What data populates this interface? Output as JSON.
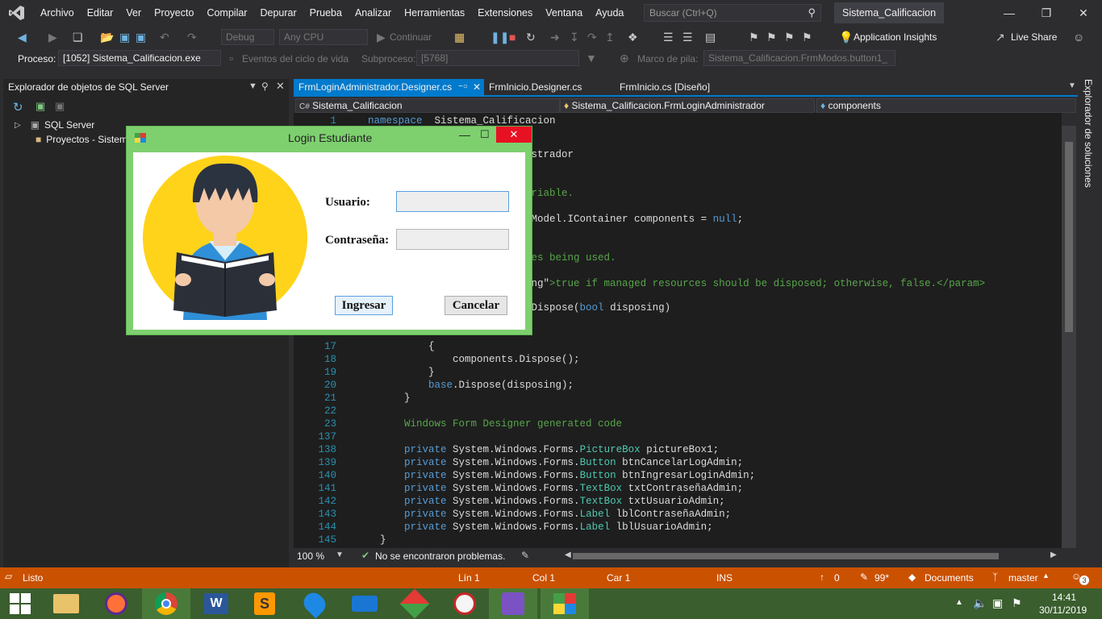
{
  "menu": [
    "Archivo",
    "Editar",
    "Ver",
    "Proyecto",
    "Compilar",
    "Depurar",
    "Prueba",
    "Analizar",
    "Herramientas",
    "Extensiones",
    "Ventana",
    "Ayuda"
  ],
  "search_placeholder": "Buscar (Ctrl+Q)",
  "solution_name": "Sistema_Calificacion",
  "toolbar": {
    "config": "Debug",
    "platform": "Any CPU",
    "continue_label": "Continuar",
    "app_insights": "Application Insights",
    "live_share": "Live Share"
  },
  "process_bar": {
    "proceso_label": "Proceso:",
    "proceso_value": "[1052] Sistema_Calificacion.exe",
    "eventos_label": "Eventos del ciclo de vida",
    "subproceso_label": "Subproceso:",
    "subproceso_value": "[5768]",
    "marco_label": "Marco de pila:",
    "marco_value": "Sistema_Calificacion.FrmModos.button1_"
  },
  "left_panel": {
    "title": "Explorador de objetos de SQL Server",
    "items": [
      "SQL Server",
      "Proyectos - Sistem"
    ]
  },
  "tabs": [
    "FrmLoginAdministrador.Designer.cs",
    "FrmInicio.Designer.cs",
    "FrmInicio.cs [Diseño]"
  ],
  "nav": {
    "project": "Sistema_Calificacion",
    "class": "Sistema_Calificacion.FrmLoginAdministrador",
    "member": "components"
  },
  "right_rail_label": "Explorador de soluciones",
  "code_lines": [
    {
      "n": "1",
      "segs": [
        [
          "kw",
          "namespace"
        ],
        [
          "",
          "  Sistema_Calificacion"
        ]
      ]
    },
    {
      "n": "",
      "segs": [
        [
          "",
          "                         nistrador"
        ]
      ]
    },
    {
      "n": "",
      "segs": [
        [
          "cm",
          "                         variable."
        ]
      ]
    },
    {
      "n": "",
      "segs": [
        [
          "",
          "                         ntModel.IContainer components = "
        ],
        [
          "kw",
          "null"
        ],
        [
          "",
          ";"
        ]
      ]
    },
    {
      "n": "",
      "segs": [
        [
          "cm",
          "                         rces being used."
        ]
      ]
    },
    {
      "n": "",
      "segs": [
        [
          "",
          "                         sing\""
        ],
        [
          "cm",
          ">true if managed resources should be disposed; otherwise, false.</param>"
        ]
      ]
    },
    {
      "n": "",
      "segs": [
        [
          "",
          "                         d Dispose("
        ],
        [
          "kw",
          "bool"
        ],
        [
          "",
          " disposing)"
        ]
      ]
    },
    {
      "n": "17",
      "segs": [
        [
          "",
          "          {"
        ]
      ]
    },
    {
      "n": "18",
      "segs": [
        [
          "",
          "              components.Dispose();"
        ]
      ]
    },
    {
      "n": "19",
      "segs": [
        [
          "",
          "          }"
        ]
      ]
    },
    {
      "n": "20",
      "segs": [
        [
          "",
          "          "
        ],
        [
          "kw",
          "base"
        ],
        [
          "",
          ".Dispose(disposing);"
        ]
      ]
    },
    {
      "n": "21",
      "segs": [
        [
          "",
          "      }"
        ]
      ]
    },
    {
      "n": "22",
      "segs": [
        [
          "",
          ""
        ]
      ]
    },
    {
      "n": "23",
      "segs": [
        [
          "",
          "      "
        ],
        [
          "cm",
          "Windows Form Designer generated code"
        ]
      ]
    },
    {
      "n": "137",
      "segs": [
        [
          "",
          ""
        ]
      ]
    },
    {
      "n": "138",
      "segs": [
        [
          "",
          "      "
        ],
        [
          "kw",
          "private"
        ],
        [
          "",
          " System.Windows.Forms."
        ],
        [
          "ty",
          "PictureBox"
        ],
        [
          "",
          " pictureBox1;"
        ]
      ]
    },
    {
      "n": "139",
      "segs": [
        [
          "",
          "      "
        ],
        [
          "kw",
          "private"
        ],
        [
          "",
          " System.Windows.Forms."
        ],
        [
          "ty",
          "Button"
        ],
        [
          "",
          " btnCancelarLogAdmin;"
        ]
      ]
    },
    {
      "n": "140",
      "segs": [
        [
          "",
          "      "
        ],
        [
          "kw",
          "private"
        ],
        [
          "",
          " System.Windows.Forms."
        ],
        [
          "ty",
          "Button"
        ],
        [
          "",
          " btnIngresarLoginAdmin;"
        ]
      ]
    },
    {
      "n": "141",
      "segs": [
        [
          "",
          "      "
        ],
        [
          "kw",
          "private"
        ],
        [
          "",
          " System.Windows.Forms."
        ],
        [
          "ty",
          "TextBox"
        ],
        [
          "",
          " txtContraseñaAdmin;"
        ]
      ]
    },
    {
      "n": "142",
      "segs": [
        [
          "",
          "      "
        ],
        [
          "kw",
          "private"
        ],
        [
          "",
          " System.Windows.Forms."
        ],
        [
          "ty",
          "TextBox"
        ],
        [
          "",
          " txtUsuarioAdmin;"
        ]
      ]
    },
    {
      "n": "143",
      "segs": [
        [
          "",
          "      "
        ],
        [
          "kw",
          "private"
        ],
        [
          "",
          " System.Windows.Forms."
        ],
        [
          "ty",
          "Label"
        ],
        [
          "",
          " lblContraseñaAdmin;"
        ]
      ]
    },
    {
      "n": "144",
      "segs": [
        [
          "",
          "      "
        ],
        [
          "kw",
          "private"
        ],
        [
          "",
          " System.Windows.Forms."
        ],
        [
          "ty",
          "Label"
        ],
        [
          "",
          " lblUsuarioAdmin;"
        ]
      ]
    },
    {
      "n": "145",
      "segs": [
        [
          "",
          "  }"
        ]
      ]
    }
  ],
  "editor_status": {
    "zoom": "100 %",
    "problems": "No se encontraron problemas."
  },
  "statusbar": {
    "ready": "Listo",
    "line": "Lín 1",
    "col": "Col 1",
    "car": "Car 1",
    "ins": "INS",
    "up": "0",
    "pen": "99*",
    "documents": "Documents",
    "branch": "master",
    "notif": "3"
  },
  "taskbar": {
    "time": "14:41",
    "date": "30/11/2019"
  },
  "dialog": {
    "title": "Login Estudiante",
    "usuario_label": "Usuario:",
    "contrasena_label": "Contraseña:",
    "ingresar_btn": "Ingresar",
    "cancelar_btn": "Cancelar"
  }
}
